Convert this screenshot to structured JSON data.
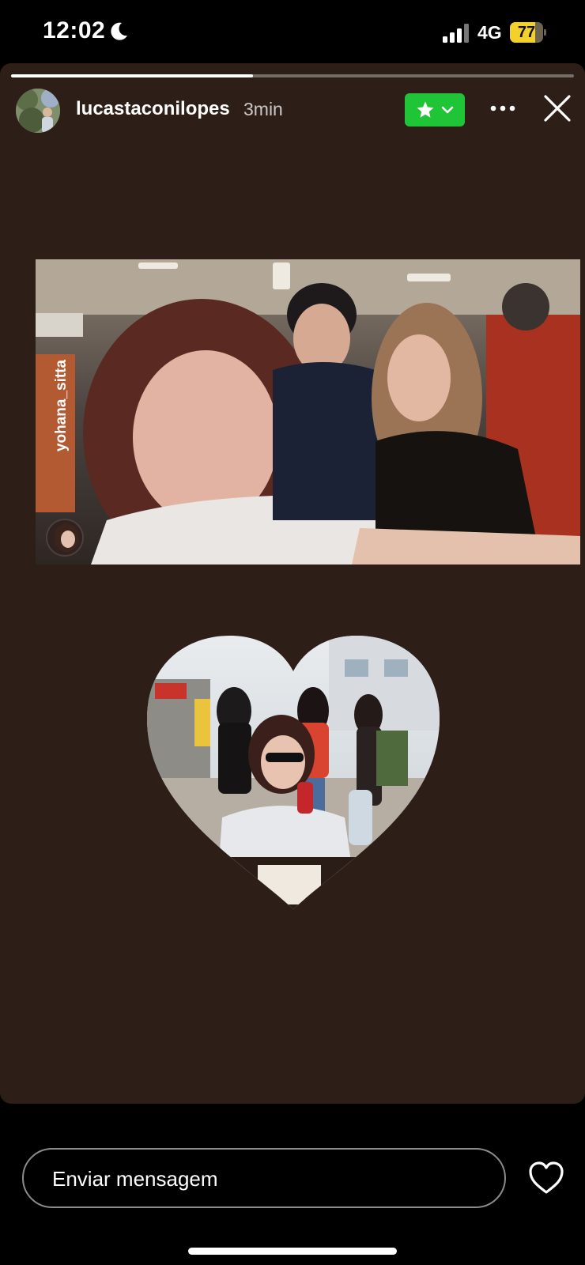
{
  "status_bar": {
    "time": "12:02",
    "network": "4G",
    "battery_level": "77",
    "battery_fraction": 0.77,
    "icons": [
      "moon-icon",
      "signal-icon",
      "battery-icon"
    ]
  },
  "story": {
    "progress_fraction": 0.43,
    "username": "lucastaconilopes",
    "time_ago": "3min",
    "colors": {
      "background": "#2d1f18",
      "close_friends": "#20c437"
    },
    "mention_tag": "yohana_sitta"
  },
  "message_bar": {
    "placeholder": "Enviar mensagem"
  }
}
